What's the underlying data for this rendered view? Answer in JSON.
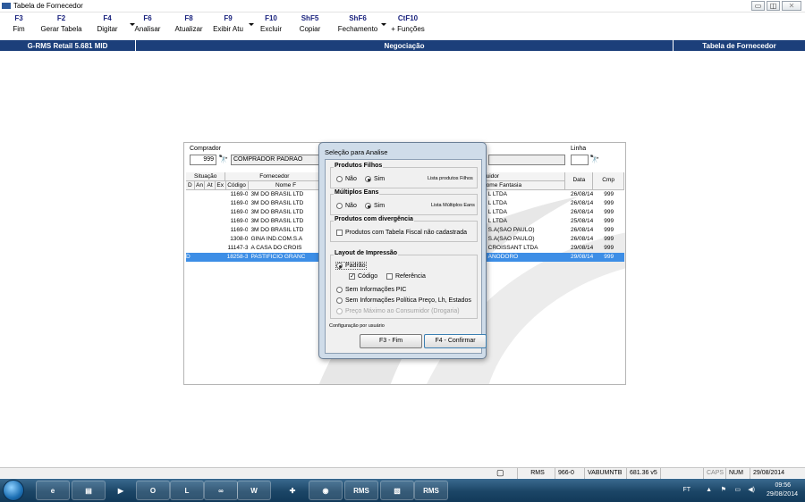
{
  "window": {
    "title": "Tabela de Fornecedor"
  },
  "toolbar": [
    {
      "key": "F3",
      "label": "Fim",
      "dropdown": false
    },
    {
      "key": "F2",
      "label": "Gerar Tabela",
      "dropdown": false
    },
    {
      "key": "F4",
      "label": "Digitar",
      "dropdown": true
    },
    {
      "key": "F6",
      "label": "Analisar",
      "dropdown": false
    },
    {
      "key": "F8",
      "label": "Atualizar",
      "dropdown": false
    },
    {
      "key": "F9",
      "label": "Exibir Atu",
      "dropdown": true
    },
    {
      "key": "F10",
      "label": "Excluir",
      "dropdown": false
    },
    {
      "key": "ShF5",
      "label": "Copiar",
      "dropdown": false
    },
    {
      "key": "ShF6",
      "label": "Fechamento",
      "dropdown": true
    },
    {
      "key": "CtF10",
      "label": "+ Funções",
      "dropdown": false
    }
  ],
  "header": {
    "left": "G-RMS Retail 5.681 MID",
    "center": "Negociação",
    "right": "Tabela de Fornecedor"
  },
  "form": {
    "comprador_label": "Comprador",
    "comprador_code": "999",
    "comprador_name": "COMPRADOR PADRAO",
    "linha_label": "Linha",
    "linha_value": ""
  },
  "table": {
    "group_situacao": "Situação",
    "group_fornecedor": "Fornecedor",
    "group_distribuidor": "uidor",
    "col_d": "D",
    "col_an": "An",
    "col_at": "At",
    "col_ex": "Ex",
    "col_codigo": "Código",
    "col_nome": "Nome F",
    "col_fantasia": "ome Fantasia",
    "col_data": "Data",
    "col_cmp": "Cmp",
    "rows": [
      {
        "d": "",
        "codigo": "1169-0",
        "nome": "3M DO BRASIL LTD",
        "fantasia": "L LTDA",
        "data": "26/08/14",
        "cmp": "999"
      },
      {
        "d": "",
        "codigo": "1169-0",
        "nome": "3M DO BRASIL LTD",
        "fantasia": "L LTDA",
        "data": "26/08/14",
        "cmp": "999"
      },
      {
        "d": "",
        "codigo": "1169-0",
        "nome": "3M DO BRASIL LTD",
        "fantasia": "L LTDA",
        "data": "26/08/14",
        "cmp": "999"
      },
      {
        "d": "",
        "codigo": "1169-0",
        "nome": "3M DO BRASIL LTD",
        "fantasia": "L LTDA",
        "data": "25/08/14",
        "cmp": "999"
      },
      {
        "d": "",
        "codigo": "1169-0",
        "nome": "3M DO BRASIL LTD",
        "fantasia": "S.A(SAO PAULO)",
        "data": "26/08/14",
        "cmp": "999"
      },
      {
        "d": "",
        "codigo": "1308-0",
        "nome": "GINA IND.COM.S.A",
        "fantasia": "S.A(SAO PAULO)",
        "data": "26/08/14",
        "cmp": "999"
      },
      {
        "d": "",
        "codigo": "11147-3",
        "nome": "A CASA DO CROIS",
        "fantasia": "CROISSANT LTDA",
        "data": "29/08/14",
        "cmp": "999"
      },
      {
        "d": "D",
        "codigo": "18258-3",
        "nome": "PASTIFICIO GRANC",
        "fantasia": "ANODORO",
        "data": "29/08/14",
        "cmp": "999"
      }
    ]
  },
  "dialog": {
    "title": "Seleção para Analise",
    "produtos_filhos": {
      "label": "Produtos Filhos",
      "nao": "Não",
      "sim": "Sim",
      "hint": "Lista produtos Filhos",
      "selected": "sim"
    },
    "multiplos_eans": {
      "label": "Múltiplos Eans",
      "nao": "Não",
      "sim": "Sim",
      "hint": "Lista Múltiplos Eans",
      "selected": "sim"
    },
    "divergencia": {
      "label": "Produtos com divergência",
      "checkbox": "Produtos com Tabela Fiscal não cadastrada",
      "checked": false
    },
    "layout": {
      "label": "Layout de Impressão",
      "padrao": "Padrão",
      "codigo": "Código",
      "codigo_checked": true,
      "referencia": "Referência",
      "referencia_checked": false,
      "sem_pic": "Sem Informações PIC",
      "sem_politica": "Sem Informações Política Preço, Lh, Estados",
      "preco_maximo": "Preço Máximo ao Consumidor (Drogaria)"
    },
    "config": "Configuração por usuário",
    "btn_fim": "F3 - Fim",
    "btn_confirmar": "F4 - Confirmar"
  },
  "statusbar": {
    "rms": "RMS",
    "code": "966-0",
    "user": "VABUMNTB",
    "version": "681.36 v5",
    "caps": "CAPS",
    "num": "NUM",
    "date": "29/08/2014"
  },
  "taskbar": {
    "items": [
      "RMS",
      "RMS"
    ],
    "tray_lang": "FT",
    "time": "09:56",
    "date": "29/08/2014"
  }
}
